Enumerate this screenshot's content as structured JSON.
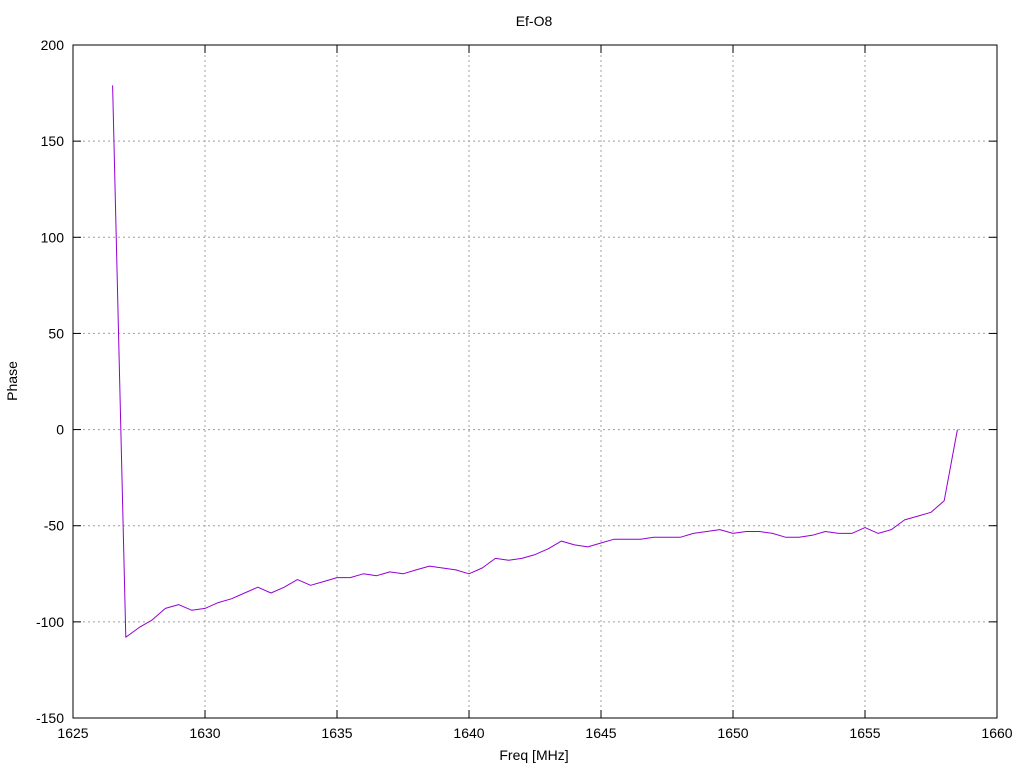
{
  "chart_data": {
    "type": "line",
    "title": "Ef-O8",
    "xlabel": "Freq [MHz]",
    "ylabel": "Phase",
    "xlim": [
      1625,
      1660
    ],
    "ylim": [
      -150,
      200
    ],
    "xticks": [
      1625,
      1630,
      1635,
      1640,
      1645,
      1650,
      1655,
      1660
    ],
    "yticks": [
      -150,
      -100,
      -50,
      0,
      50,
      100,
      150,
      200
    ],
    "grid": true,
    "legend": false,
    "series": [
      {
        "color": "#9400d3",
        "x": [
          1626.5,
          1627.0,
          1627.5,
          1628.0,
          1628.5,
          1629.0,
          1629.5,
          1630.0,
          1630.5,
          1631.0,
          1631.5,
          1632.0,
          1632.5,
          1633.0,
          1633.5,
          1634.0,
          1634.5,
          1635.0,
          1635.5,
          1636.0,
          1636.5,
          1637.0,
          1637.5,
          1638.0,
          1638.5,
          1639.0,
          1639.5,
          1640.0,
          1640.5,
          1641.0,
          1641.5,
          1642.0,
          1642.5,
          1643.0,
          1643.5,
          1644.0,
          1644.5,
          1645.0,
          1645.5,
          1646.0,
          1646.5,
          1647.0,
          1647.5,
          1648.0,
          1648.5,
          1649.0,
          1649.5,
          1650.0,
          1650.5,
          1651.0,
          1651.5,
          1652.0,
          1652.5,
          1653.0,
          1653.5,
          1654.0,
          1654.5,
          1655.0,
          1655.5,
          1656.0,
          1656.5,
          1657.0,
          1657.5,
          1658.0,
          1658.5
        ],
        "y": [
          179,
          -108,
          -103,
          -99,
          -93,
          -91,
          -94,
          -93,
          -90,
          -88,
          -85,
          -82,
          -85,
          -82,
          -78,
          -81,
          -79,
          -77,
          -77,
          -75,
          -76,
          -74,
          -75,
          -73,
          -71,
          -72,
          -73,
          -75,
          -72,
          -67,
          -68,
          -67,
          -65,
          -62,
          -58,
          -60,
          -61,
          -59,
          -57,
          -57,
          -57,
          -56,
          -56,
          -56,
          -54,
          -53,
          -52,
          -54,
          -53,
          -53,
          -54,
          -56,
          -56,
          -55,
          -53,
          -54,
          -54,
          -51,
          -54,
          -52,
          -47,
          -45,
          -43,
          -37,
          0
        ]
      }
    ]
  }
}
